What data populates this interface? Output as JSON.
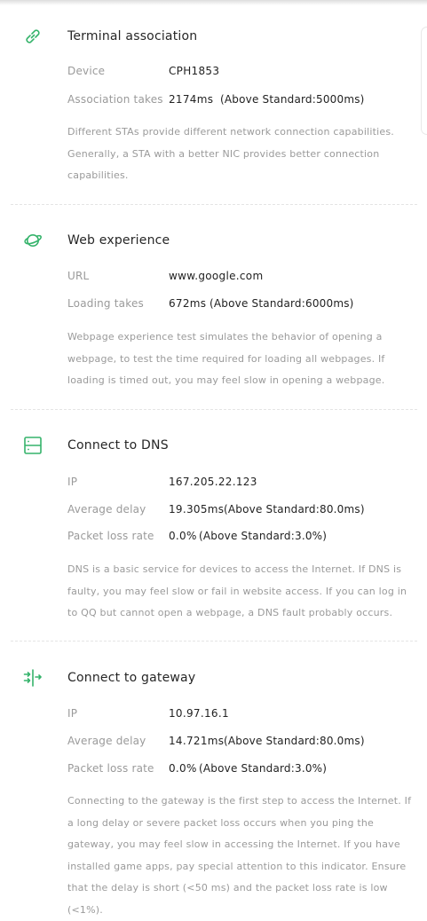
{
  "accent_color": "#35b36b",
  "sections": [
    {
      "icon": "link-icon",
      "title": "Terminal association",
      "rows": [
        {
          "label": "Device",
          "value": "CPH1853",
          "standard": ""
        },
        {
          "label": "Association takes",
          "value": "2174ms",
          "standard": "(Above Standard:5000ms)"
        }
      ],
      "description": "Different STAs provide different network connection capabilities. Generally, a STA with a better NIC provides better connection capabilities."
    },
    {
      "icon": "planet-icon",
      "title": "Web experience",
      "rows": [
        {
          "label": "URL",
          "value": "www.google.com",
          "standard": ""
        },
        {
          "label": "Loading takes",
          "value": "672ms",
          "standard": "(Above Standard:6000ms)"
        }
      ],
      "description": "Webpage experience test simulates the behavior of opening a webpage, to test the time required for loading all webpages. If loading is timed out, you may feel slow in opening a webpage."
    },
    {
      "icon": "server-icon",
      "title": "Connect to DNS",
      "rows": [
        {
          "label": "IP",
          "value": "167.205.22.123",
          "standard": ""
        },
        {
          "label": "Average delay",
          "value": "19.305ms",
          "standard": "(Above Standard:80.0ms)"
        },
        {
          "label": "Packet loss rate",
          "value": "0.0%",
          "standard": "(Above Standard:3.0%)"
        }
      ],
      "description": "DNS is a basic service for devices to access the Internet. If DNS is faulty, you may feel slow or fail in website access. If you can log in to QQ but cannot open a webpage, a DNS fault probably occurs."
    },
    {
      "icon": "gateway-arrows-icon",
      "title": "Connect to gateway",
      "rows": [
        {
          "label": "IP",
          "value": "10.97.16.1",
          "standard": ""
        },
        {
          "label": "Average delay",
          "value": "14.721ms",
          "standard": "(Above Standard:80.0ms)"
        },
        {
          "label": "Packet loss rate",
          "value": "0.0%",
          "standard": "(Above Standard:3.0%)"
        }
      ],
      "description": "Connecting to the gateway is the first step to access the Internet. If a long delay or severe packet loss occurs when you ping the gateway, you may feel slow in accessing the Internet. If you have installed game apps, pay special attention to this indicator. Ensure that the delay is short (<50 ms) and the packet loss rate is low (<1%)."
    }
  ]
}
